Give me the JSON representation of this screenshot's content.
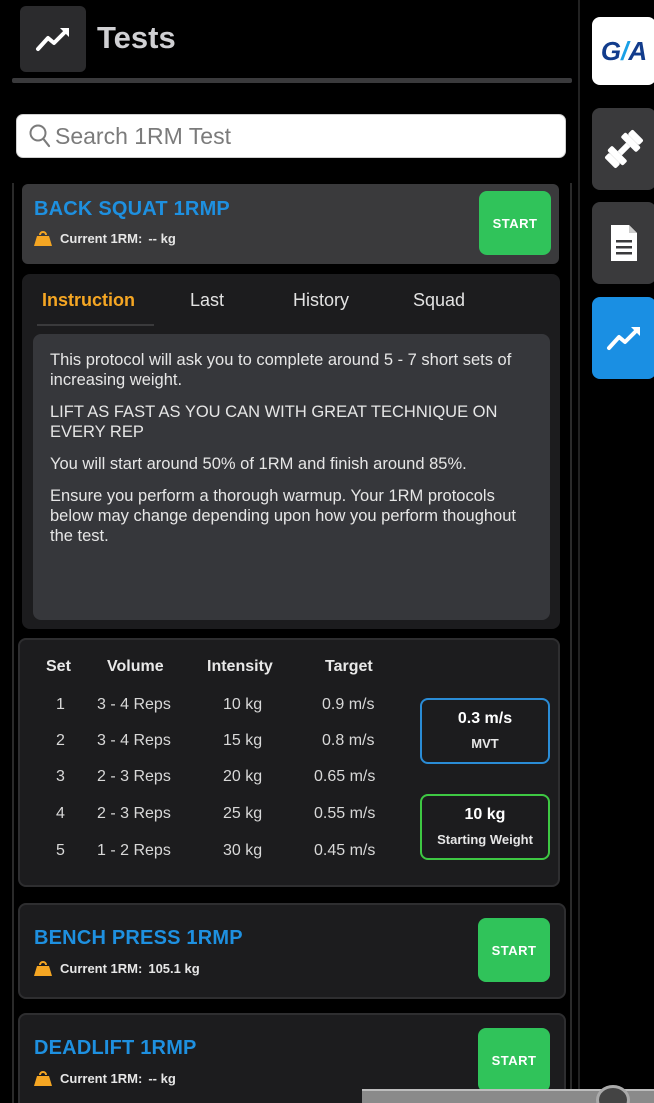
{
  "header": {
    "title": "Tests",
    "icon": "trend-chart-icon"
  },
  "search": {
    "placeholder": "Search 1RM Test"
  },
  "cards": [
    {
      "title": "BACK SQUAT 1RMP",
      "current_label": "Current 1RM:",
      "current_value": "-- kg",
      "start_label": "START"
    },
    {
      "title": "BENCH PRESS 1RMP",
      "current_label": "Current 1RM:",
      "current_value": "105.1 kg",
      "start_label": "START"
    },
    {
      "title": "DEADLIFT 1RMP",
      "current_label": "Current 1RM:",
      "current_value": "-- kg",
      "start_label": "START"
    }
  ],
  "tabs": [
    {
      "label": "Instruction",
      "active": true
    },
    {
      "label": "Last",
      "active": false
    },
    {
      "label": "History",
      "active": false
    },
    {
      "label": "Squad",
      "active": false
    }
  ],
  "instructions": [
    "This protocol will ask you to complete around 5 - 7 short sets of increasing weight.",
    "LIFT AS FAST AS YOU CAN WITH GREAT TECHNIQUE ON EVERY REP",
    "You will start around 50% of 1RM and finish around 85%.",
    "Ensure you perform a thorough warmup. Your 1RM protocols below may change depending upon how you perform thoughout the test."
  ],
  "protocol": {
    "headers": {
      "set": "Set",
      "volume": "Volume",
      "intensity": "Intensity",
      "target": "Target"
    },
    "rows": [
      {
        "set": "1",
        "volume": "3 - 4 Reps",
        "intensity": "10 kg",
        "target": "0.9 m/s"
      },
      {
        "set": "2",
        "volume": "3 - 4 Reps",
        "intensity": "15 kg",
        "target": "0.8 m/s"
      },
      {
        "set": "3",
        "volume": "2 - 3 Reps",
        "intensity": "20 kg",
        "target": "0.65 m/s"
      },
      {
        "set": "4",
        "volume": "2 - 3 Reps",
        "intensity": "25 kg",
        "target": "0.55 m/s"
      },
      {
        "set": "5",
        "volume": "1 - 2 Reps",
        "intensity": "30 kg",
        "target": "0.45 m/s"
      }
    ],
    "mvt": {
      "value": "0.3 m/s",
      "caption": "MVT"
    },
    "starting_weight": {
      "value": "10 kg",
      "caption": "Starting Weight"
    }
  },
  "nav": {
    "logo": {
      "part1": "G",
      "slash": "/",
      "part2": "A"
    },
    "items": [
      {
        "name": "nav-exercise",
        "icon": "dumbbell-icon",
        "active": false
      },
      {
        "name": "nav-reports",
        "icon": "document-icon",
        "active": false
      },
      {
        "name": "nav-tests",
        "icon": "trend-chart-icon",
        "active": true
      }
    ]
  },
  "colors": {
    "accent_blue": "#1e90e0",
    "active_tab": "#f5a623",
    "start_green": "#30c35a",
    "mvt_border": "#2a8cd6",
    "weight_border": "#3ec843",
    "nav_active": "#1a8fe3"
  }
}
